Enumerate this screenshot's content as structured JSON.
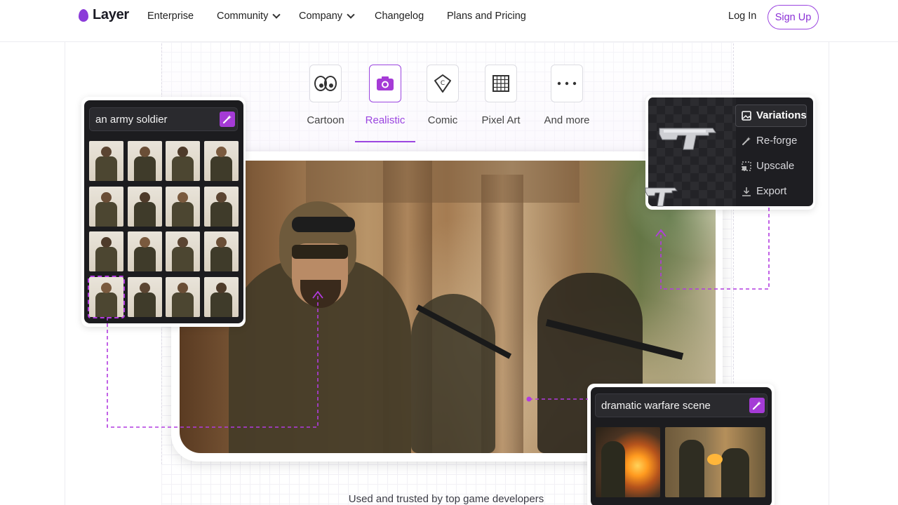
{
  "brand": {
    "name": "Layer",
    "accent": "#9b45e0"
  },
  "nav": {
    "items": [
      {
        "label": "Enterprise",
        "dropdown": false
      },
      {
        "label": "Community",
        "dropdown": true
      },
      {
        "label": "Company",
        "dropdown": true
      },
      {
        "label": "Changelog",
        "dropdown": false
      },
      {
        "label": "Plans and Pricing",
        "dropdown": false
      }
    ],
    "login": "Log In",
    "signup": "Sign Up"
  },
  "styles": {
    "tabs": [
      {
        "label": "Cartoon",
        "icon": "eyes-icon",
        "active": false
      },
      {
        "label": "Realistic",
        "icon": "camera-icon",
        "active": true
      },
      {
        "label": "Comic",
        "icon": "comic-badge-icon",
        "active": false
      },
      {
        "label": "Pixel Art",
        "icon": "pixel-grid-icon",
        "active": false
      },
      {
        "label": "And more",
        "icon": "more-dots-icon",
        "active": false
      }
    ]
  },
  "left_panel": {
    "prompt": "an army soldier",
    "grid": {
      "rows": 4,
      "cols": 4,
      "selected_index": 12
    }
  },
  "right_panel": {
    "menu": [
      {
        "label": "Variations",
        "icon": "image-icon",
        "active": true
      },
      {
        "label": "Re-forge",
        "icon": "wand-icon",
        "active": false
      },
      {
        "label": "Upscale",
        "icon": "upscale-icon",
        "active": false
      },
      {
        "label": "Export",
        "icon": "download-icon",
        "active": false
      }
    ]
  },
  "scene_panel": {
    "prompt": "dramatic warfare scene"
  },
  "footer": {
    "trusted": "Used and trusted by top game developers"
  }
}
